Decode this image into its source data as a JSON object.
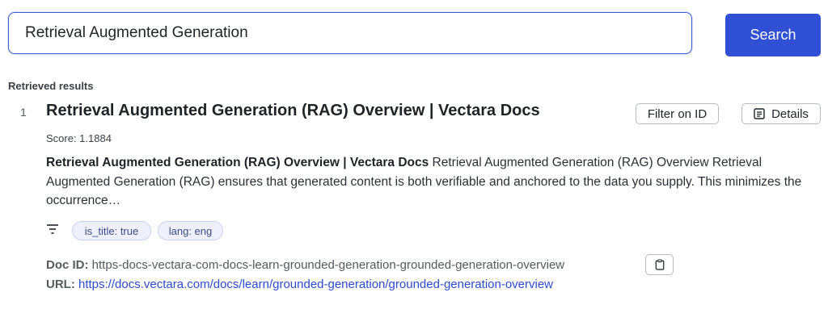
{
  "search": {
    "value": "Retrieval Augmented Generation",
    "button_label": "Search"
  },
  "results_heading": "Retrieved results",
  "results": [
    {
      "rank": "1",
      "title": "Retrieval Augmented Generation (RAG) Overview | Vectara Docs",
      "filter_label": "Filter on ID",
      "details_label": "Details",
      "score": "Score: 1.1884",
      "snippet_bold": "Retrieval Augmented Generation (RAG) Overview | Vectara Docs",
      "snippet_rest": " Retrieval Augmented Generation (RAG) Overview Retrieval Augmented Generation (RAG) ensures that generated content is both verifiable and anchored to the data you supply. This minimizes the occurrence…",
      "tags": [
        "is_title: true",
        "lang: eng"
      ],
      "doc_id_label": "Doc ID:",
      "doc_id": "https-docs-vectara-com-docs-learn-grounded-generation-grounded-generation-overview",
      "url_label": "URL:",
      "url": "https://docs.vectara.com/docs/learn/grounded-generation/grounded-generation-overview"
    }
  ],
  "icons": {
    "details": "document-list-icon",
    "filter": "filter-lines-icon",
    "copy": "clipboard-icon"
  },
  "colors": {
    "accent": "#2f4fd4",
    "link": "#2c4bd1",
    "tag_bg": "#eef1fb"
  }
}
